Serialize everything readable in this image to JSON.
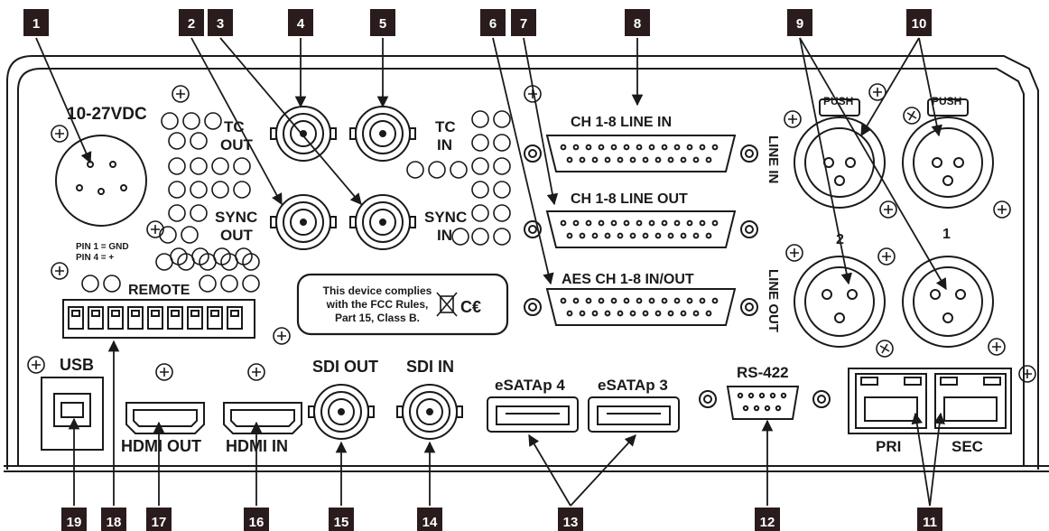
{
  "callouts": [
    "1",
    "2",
    "3",
    "4",
    "5",
    "6",
    "7",
    "8",
    "9",
    "10",
    "11",
    "12",
    "13",
    "14",
    "15",
    "16",
    "17",
    "18",
    "19"
  ],
  "labels": {
    "power": "10-27VDC",
    "tc_out_1": "TC",
    "tc_out_2": "OUT",
    "tc_in_1": "TC",
    "tc_in_2": "IN",
    "sync_out_1": "SYNC",
    "sync_out_2": "OUT",
    "sync_in_1": "SYNC",
    "sync_in_2": "IN",
    "line_in_db": "CH 1-8 LINE IN",
    "line_out_db": "CH 1-8 LINE OUT",
    "aes_db": "AES CH 1-8 IN/OUT",
    "push_left": "PUSH",
    "push_right": "PUSH",
    "line_in_side": "LINE IN",
    "line_out_side": "LINE OUT",
    "xlr_2": "2",
    "xlr_1": "1",
    "pin1": "PIN 1 = GND",
    "pin4": "PIN 4 = +",
    "remote": "REMOTE",
    "fcc_1": "This device complies",
    "fcc_2": "with the FCC Rules,",
    "fcc_3": "Part 15, Class B.",
    "ce": "C€",
    "usb": "USB",
    "hdmi_out": "HDMI OUT",
    "hdmi_in": "HDMI IN",
    "sdi_out": "SDI OUT",
    "sdi_in": "SDI IN",
    "esata4": "eSATAp 4",
    "esata3": "eSATAp 3",
    "rs422": "RS-422",
    "pri": "PRI",
    "sec": "SEC"
  }
}
